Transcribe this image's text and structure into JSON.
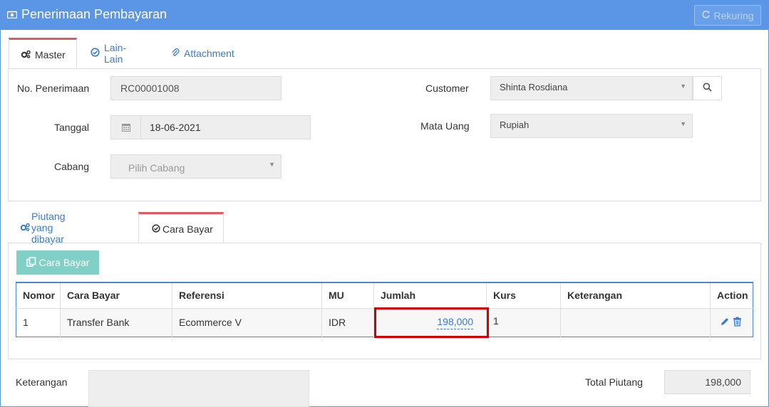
{
  "header": {
    "title": "Penerimaan Pembayaran",
    "rekuring_label": "Rekuring"
  },
  "tabs_top": [
    {
      "label": "Master"
    },
    {
      "label": "Lain-Lain"
    },
    {
      "label": "Attachment"
    }
  ],
  "form": {
    "no_penerimaan_label": "No. Penerimaan",
    "no_penerimaan_value": "RC00001008",
    "tanggal_label": "Tanggal",
    "tanggal_value": "18-06-2021",
    "cabang_label": "Cabang",
    "cabang_placeholder": "Pilih Cabang",
    "customer_label": "Customer",
    "customer_value": "Shinta Rosdiana",
    "mata_uang_label": "Mata Uang",
    "mata_uang_value": "Rupiah"
  },
  "tabs_bottom": [
    {
      "label": "Piutang yang dibayar"
    },
    {
      "label": "Cara Bayar"
    }
  ],
  "cara_bayar_button": "Cara Bayar",
  "table": {
    "headers": [
      "Nomor",
      "Cara Bayar",
      "Referensi",
      "MU",
      "Jumlah",
      "Kurs",
      "Keterangan",
      "Action"
    ],
    "rows": [
      {
        "nomor": "1",
        "cara_bayar": "Transfer Bank",
        "referensi": "Ecommerce V",
        "mu": "IDR",
        "jumlah": "198,000",
        "kurs": "1",
        "keterangan": ""
      }
    ]
  },
  "footer": {
    "keterangan_label": "Keterangan",
    "total_piutang_label": "Total Piutang",
    "total_piutang_value": "198,000"
  },
  "colors": {
    "header": "#5b95e6",
    "accent": "#3a7bc8",
    "active_tab": "#e05a5a",
    "cara_bayar_btn": "#80d0c7",
    "highlight": "#d40000"
  },
  "icons": {
    "title": "camera-icon",
    "rekuring": "refresh-icon",
    "master": "cogs-icon",
    "lain": "check-circle-icon",
    "attachment": "paperclip-icon",
    "calendar": "calendar-icon",
    "search": "search-icon",
    "piutang": "cogs-icon",
    "cara_bayar": "check-circle-icon",
    "cb_button": "copy-icon",
    "edit": "pencil-icon",
    "delete": "trash-icon"
  }
}
